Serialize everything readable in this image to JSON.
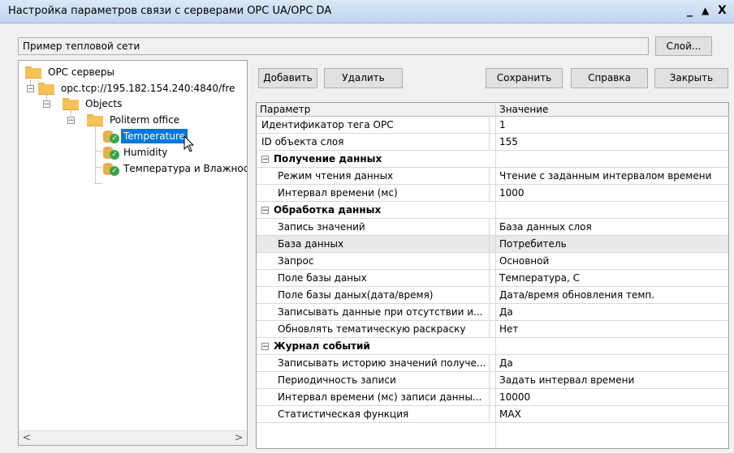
{
  "window": {
    "title": "Настройка параметров связи с серверами OPC UA/OPC DA",
    "controls": {
      "minimize": "_",
      "maximize": "▲",
      "close": "X"
    }
  },
  "layer": {
    "value": "Пример тепловой сети",
    "button_label": "Слой..."
  },
  "toolbar": {
    "add_label": "Добавить",
    "delete_label": "Удалить",
    "save_label": "Сохранить",
    "help_label": "Справка",
    "close_label": "Закрыть"
  },
  "tree": {
    "root": "OPC серверы",
    "server": "opc.tcp://195.182.154.240:4840/fre",
    "objects": "Objects",
    "politerm": "Politerm office",
    "tags": [
      "Temperature",
      "Humidity",
      "Температура и Влажнос"
    ],
    "scroll_left": "<",
    "scroll_right": ">"
  },
  "grid": {
    "col_param": "Параметр",
    "col_value": "Значение",
    "rows": [
      {
        "type": "prop",
        "name": "Идентификатор тега OPC",
        "value": "1"
      },
      {
        "type": "prop",
        "name": "ID объекта слоя",
        "value": "155"
      },
      {
        "type": "cat",
        "name": "Получение данных"
      },
      {
        "type": "sub",
        "name": "Режим чтения данных",
        "value": "Чтение с заданным интервалом времени"
      },
      {
        "type": "sub",
        "name": "Интервал времени (мс)",
        "value": "1000"
      },
      {
        "type": "cat",
        "name": "Обработка данных"
      },
      {
        "type": "sub",
        "name": "Запись значений",
        "value": "База данных слоя"
      },
      {
        "type": "sub",
        "name": "База данных",
        "value": "Потребитель"
      },
      {
        "type": "sub",
        "name": "Запрос",
        "value": "Основной"
      },
      {
        "type": "sub",
        "name": "Поле базы даных",
        "value": "Температура, С"
      },
      {
        "type": "sub",
        "name": "Поле базы даных(дата/время)",
        "value": "Дата/время обновления темп."
      },
      {
        "type": "sub",
        "name": "Записывать данные при отсутствии и...",
        "value": "Да"
      },
      {
        "type": "sub",
        "name": "Обновлять тематическую раскраску",
        "value": "Нет"
      },
      {
        "type": "cat",
        "name": "Журнал событий"
      },
      {
        "type": "sub",
        "name": "Записывать историю значений получе...",
        "value": "Да"
      },
      {
        "type": "sub",
        "name": "Периодичность записи",
        "value": "Задать интервал времени"
      },
      {
        "type": "sub",
        "name": "Интервал времени (мс) записи данны...",
        "value": "10000"
      },
      {
        "type": "sub",
        "name": "Статистическая функция",
        "value": "MAX"
      }
    ]
  }
}
